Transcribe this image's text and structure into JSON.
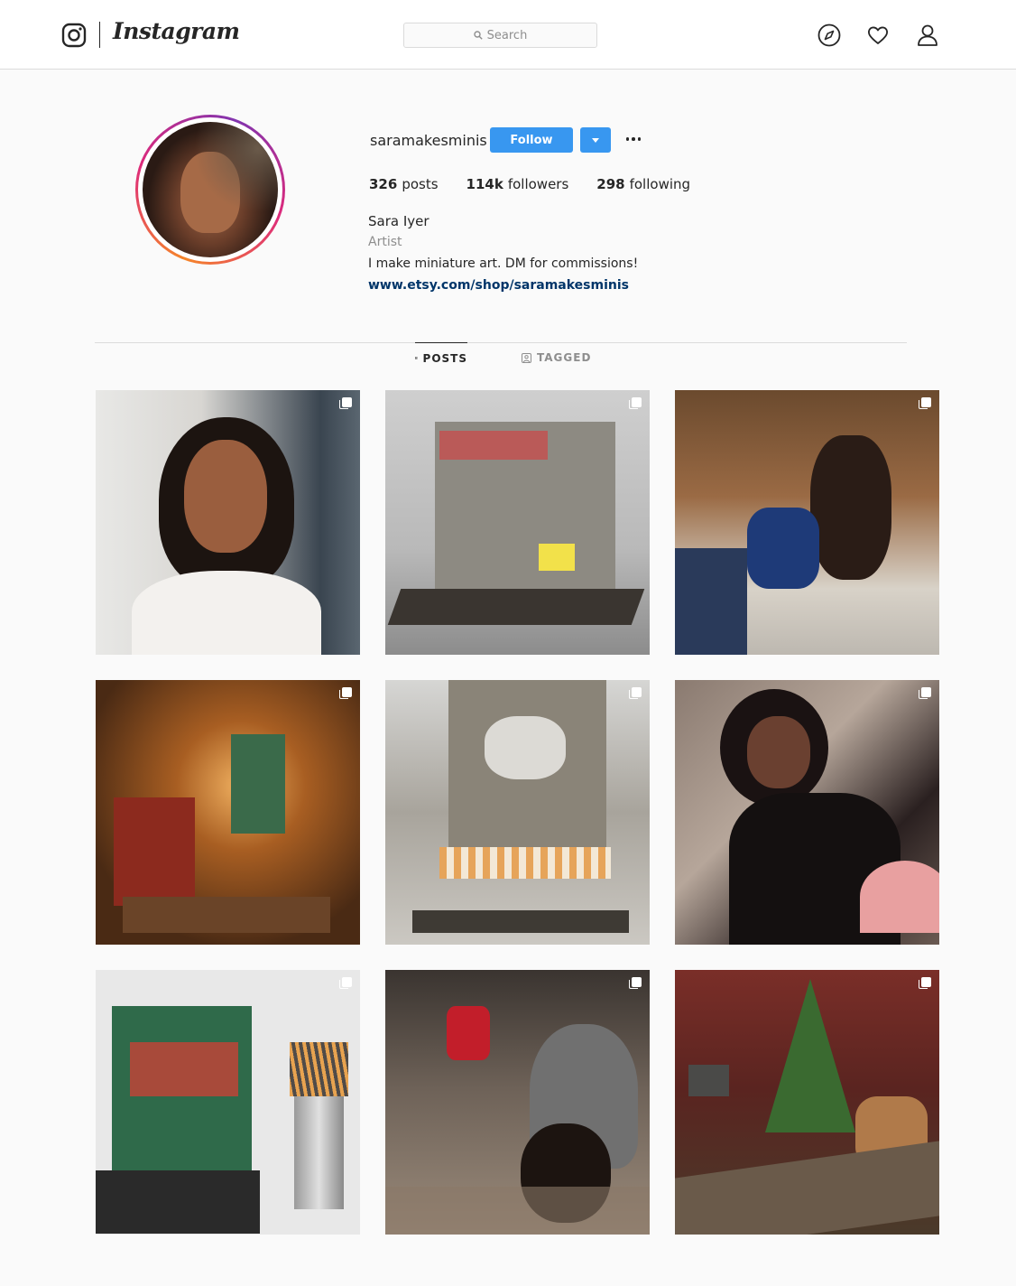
{
  "header": {
    "wordmark": "Instagram",
    "search_placeholder": "Search",
    "icons": [
      "instagram-logo-icon",
      "search-icon",
      "explore-compass-icon",
      "heart-icon",
      "profile-icon"
    ]
  },
  "profile": {
    "username": "saramakesminis",
    "follow_label": "Follow",
    "stats": {
      "posts_count": "326",
      "posts_label": "posts",
      "followers_count": "114k",
      "followers_label": "followers",
      "following_count": "298",
      "following_label": "following"
    },
    "full_name": "Sara Iyer",
    "category": "Artist",
    "bio": "I make miniature art. DM for commissions!",
    "website": "www.etsy.com/shop/saramakesminis"
  },
  "tabs": [
    {
      "label": "POSTS",
      "active": true,
      "icon": "grid-icon"
    },
    {
      "label": "TAGGED",
      "active": false,
      "icon": "tagged-icon"
    }
  ],
  "posts": [
    {
      "type": "multiple"
    },
    {
      "type": "multiple"
    },
    {
      "type": "multiple"
    },
    {
      "type": "multiple"
    },
    {
      "type": "multiple"
    },
    {
      "type": "multiple"
    },
    {
      "type": "multiple"
    },
    {
      "type": "multiple"
    },
    {
      "type": "multiple"
    }
  ],
  "colors": {
    "accent": "#3897f0",
    "link": "#003569",
    "text": "#262626",
    "muted": "#8e8e8e",
    "border": "#dbdbdb",
    "background": "#fafafa"
  }
}
